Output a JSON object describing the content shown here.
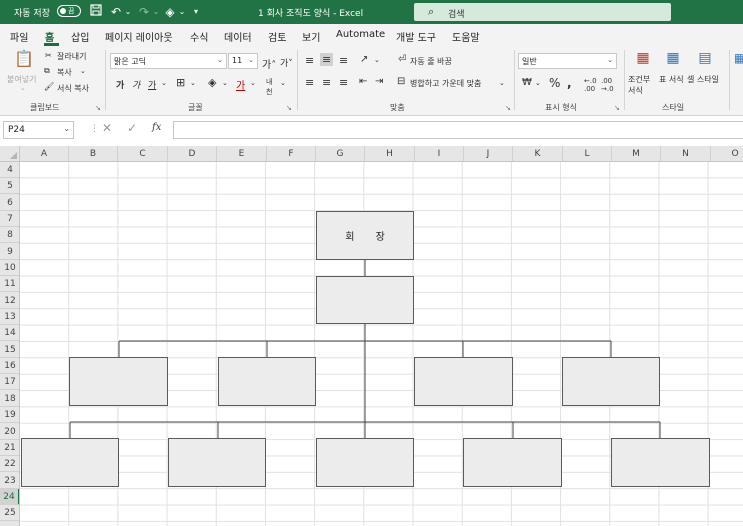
{
  "titlebar": {
    "autosave_label": "자동 저장",
    "autosave_state": "끔",
    "document_title": "1 회사 조직도 양식  -  Excel",
    "search_placeholder": "검색"
  },
  "ribbon_tabs": [
    "파일",
    "홈",
    "삽입",
    "페이지 레이아웃",
    "수식",
    "데이터",
    "검토",
    "보기",
    "Automate",
    "개발 도구",
    "도움말"
  ],
  "active_tab": "홈",
  "ribbon": {
    "clipboard": {
      "paste": "붙여넣기",
      "cut": "잘라내기",
      "copy": "복사",
      "format_painter": "서식 복사",
      "group_label": "클립보드"
    },
    "font": {
      "font_name": "맑은 고딕",
      "font_size": "11",
      "group_label": "글꼴"
    },
    "alignment": {
      "wrap_text": "자동 줄 바꿈",
      "merge_center": "병합하고 가운데 맞춤",
      "group_label": "맞춤"
    },
    "number": {
      "format": "일반",
      "group_label": "표시 형식"
    },
    "styles": {
      "conditional": "조건부 서식",
      "table": "표 서식",
      "cell": "셀 스타일",
      "group_label": "스타일"
    }
  },
  "formula_bar": {
    "name_box": "P24",
    "fx_label": "fx",
    "formula": ""
  },
  "grid": {
    "columns": [
      "A",
      "B",
      "C",
      "D",
      "E",
      "F",
      "G",
      "H",
      "I",
      "J",
      "K",
      "L",
      "M",
      "N",
      "O"
    ],
    "rows": [
      "4",
      "5",
      "6",
      "7",
      "8",
      "9",
      "10",
      "11",
      "12",
      "13",
      "14",
      "15",
      "16",
      "17",
      "18",
      "19",
      "20",
      "21",
      "22",
      "23",
      "24",
      "25"
    ],
    "selected_row": "24"
  },
  "org_chart": {
    "chairman_label": "회 장"
  },
  "colors": {
    "excel_green": "#217346",
    "box_fill": "#ececec"
  }
}
